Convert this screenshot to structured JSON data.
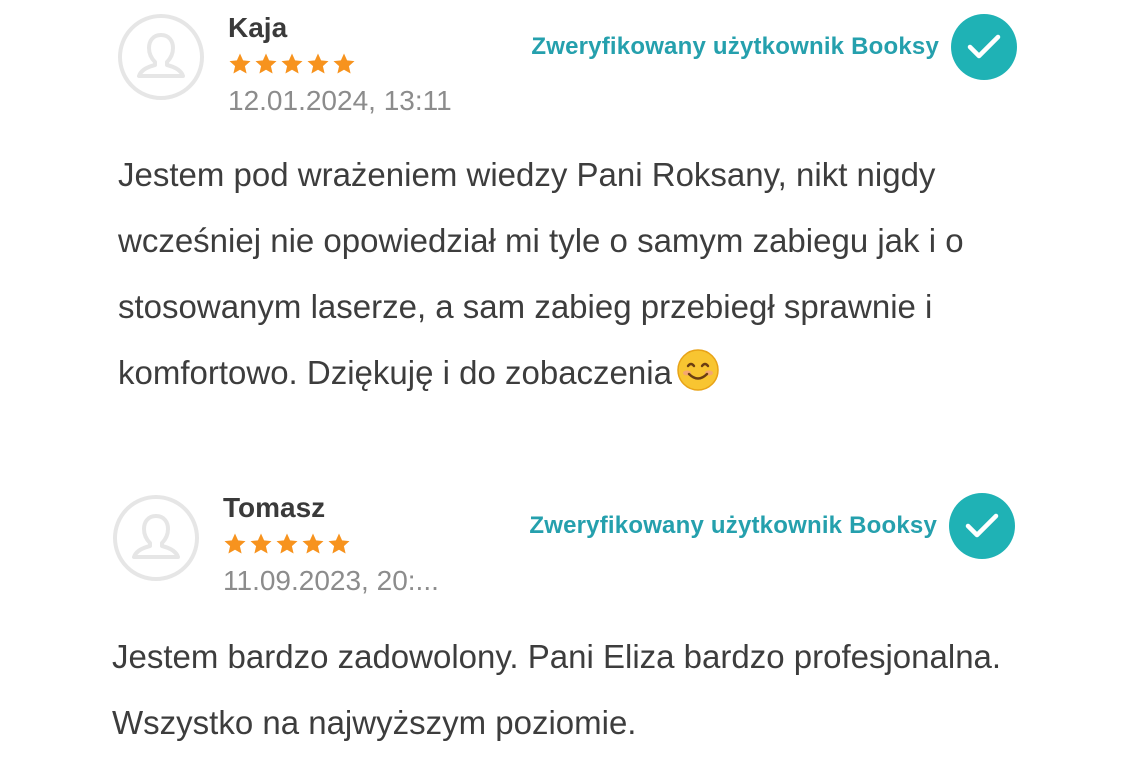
{
  "reviews": [
    {
      "author": "Kaja",
      "rating": 5,
      "date": "12.01.2024, 13:11",
      "verified_label": "Zweryfikowany użytkownik Booksy",
      "text": "Jestem pod wrażeniem wiedzy Pani Roksany, nikt nigdy wcześniej nie opowiedział mi tyle o samym zabiegu jak i o stosowanym laserze, a sam zabieg przebiegł sprawnie i komfortowo. Dziękuję i do zobaczenia",
      "emoji": "smiling-face-emoji"
    },
    {
      "author": "Tomasz",
      "rating": 5,
      "date": "11.09.2023, 20:...",
      "verified_label": "Zweryfikowany użytkownik Booksy",
      "text": "Jestem bardzo zadowolony. Pani Eliza bardzo profesjonalna. Wszystko na najwyższym poziomie."
    }
  ],
  "colors": {
    "star": "#f7931e",
    "verified_text": "#25a0ad",
    "verified_icon_bg": "#1fb2b5",
    "avatar_stroke": "#e6e6e6",
    "text": "#3d3d3d",
    "date": "#8c8c8c"
  },
  "icons": {
    "avatar": "user-silhouette-icon",
    "star": "star-icon",
    "verified": "checkmark-circle-icon"
  }
}
